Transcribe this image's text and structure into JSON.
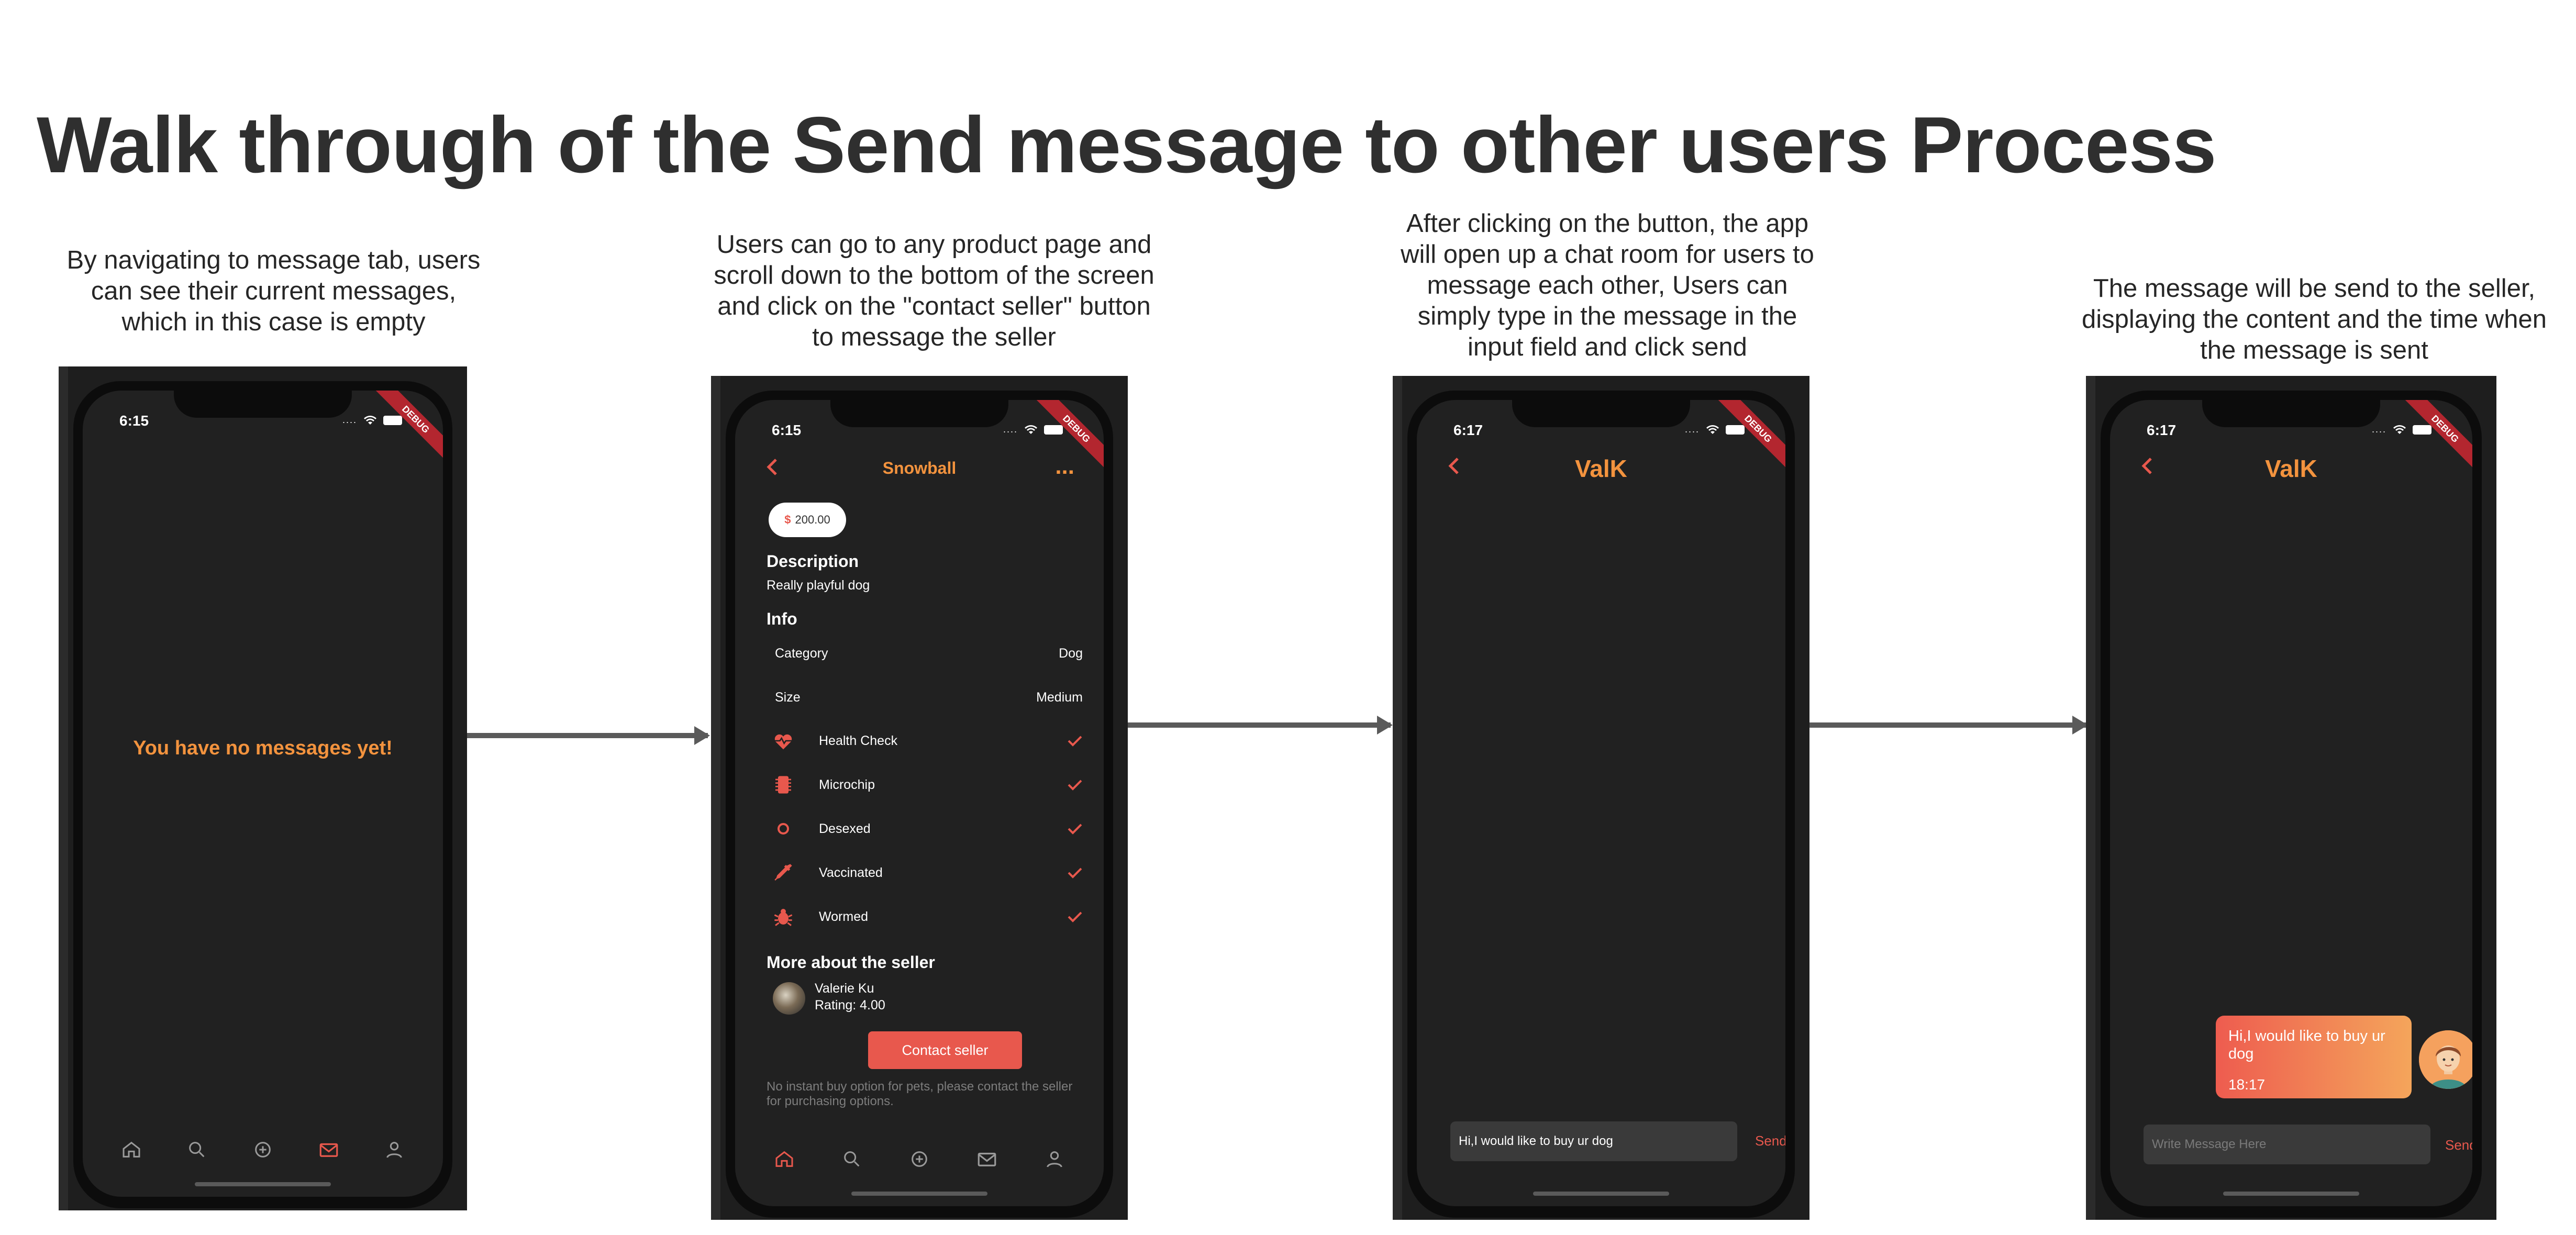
{
  "title": "Walk through of the Send message to other users Process",
  "steps": [
    {
      "caption": "By navigating to message tab, users can see their current messages, which in this case is empty"
    },
    {
      "caption": "Users can go to any product page and scroll down to the bottom of the screen and click on the \"contact seller\" button to message the seller"
    },
    {
      "caption": "After clicking on the button, the app will open up a chat room for users to message each other, Users can simply type in the message in the input field and click send"
    },
    {
      "caption": "The message will be send to the seller, displaying the content and the time when the message is sent"
    }
  ],
  "screen1": {
    "time": "6:15",
    "debug": "DEBUG",
    "empty_message": "You have no messages yet!",
    "tabs": [
      "home-icon",
      "search-icon",
      "add-circle-icon",
      "mail-icon",
      "profile-icon"
    ],
    "active_tab": "mail-icon"
  },
  "screen2": {
    "time": "6:15",
    "debug": "DEBUG",
    "title": "Snowball",
    "more": "...",
    "price": "200.00",
    "currency_symbol": "$",
    "description_heading": "Description",
    "description": "Really playful dog",
    "info_heading": "Info",
    "info": [
      {
        "label": "Category",
        "value": "Dog"
      },
      {
        "label": "Size",
        "value": "Medium"
      }
    ],
    "features": [
      {
        "label": "Health Check",
        "icon": "heart-pulse-icon",
        "checked": true
      },
      {
        "label": "Microchip",
        "icon": "chip-icon",
        "checked": true
      },
      {
        "label": "Desexed",
        "icon": "circle-icon",
        "checked": true
      },
      {
        "label": "Vaccinated",
        "icon": "syringe-icon",
        "checked": true
      },
      {
        "label": "Wormed",
        "icon": "bug-icon",
        "checked": true
      }
    ],
    "seller_heading": "More about the seller",
    "seller_name": "Valerie Ku",
    "seller_rating": "Rating: 4.00",
    "contact_button": "Contact seller",
    "note": "No instant buy option for pets, please contact the seller for purchasing options.",
    "active_tab": "home-icon"
  },
  "screen3": {
    "time": "6:17",
    "debug": "DEBUG",
    "title": "ValK",
    "input_value": "Hi,I would like to buy ur dog",
    "send_label": "Send"
  },
  "screen4": {
    "time": "6:17",
    "debug": "DEBUG",
    "title": "ValK",
    "message_text": "Hi,I would like to buy ur dog",
    "message_time": "18:17",
    "input_placeholder": "Write Message Here",
    "send_label": "Send"
  },
  "colors": {
    "accent": "#f3933e",
    "red": "#e8584d",
    "screen_bg": "#212121",
    "title_text": "#2f2f2f"
  }
}
